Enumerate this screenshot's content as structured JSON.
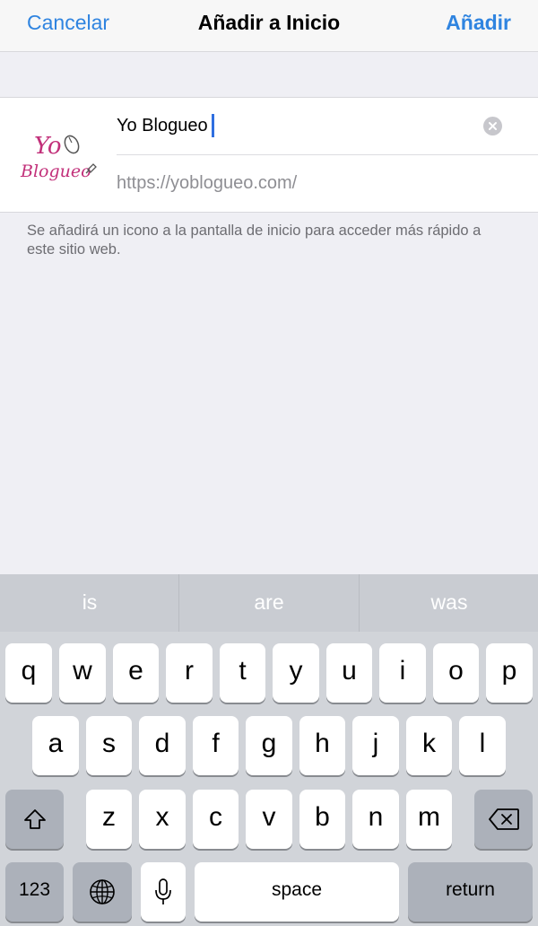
{
  "navbar": {
    "cancel_label": "Cancelar",
    "title": "Añadir a Inicio",
    "add_label": "Añadir"
  },
  "site": {
    "icon_text_line1": "Yo",
    "icon_text_line2": "Blogueo",
    "name_value": "Yo Blogueo",
    "url": "https://yoblogueo.com/"
  },
  "info_text": "Se añadirá un icono a la pantalla de inicio para acceder más rápido a este sitio web.",
  "keyboard": {
    "suggestions": [
      "is",
      "are",
      "was"
    ],
    "row1": [
      "q",
      "w",
      "e",
      "r",
      "t",
      "y",
      "u",
      "i",
      "o",
      "p"
    ],
    "row2": [
      "a",
      "s",
      "d",
      "f",
      "g",
      "h",
      "j",
      "k",
      "l"
    ],
    "row3": [
      "z",
      "x",
      "c",
      "v",
      "b",
      "n",
      "m"
    ],
    "numbers_label": "123",
    "space_label": "space",
    "return_label": "return"
  },
  "colors": {
    "accent": "#2f84e0",
    "background": "#efeff4",
    "keyboard_bg": "#d1d4d9",
    "icon_pink": "#c2307a"
  }
}
